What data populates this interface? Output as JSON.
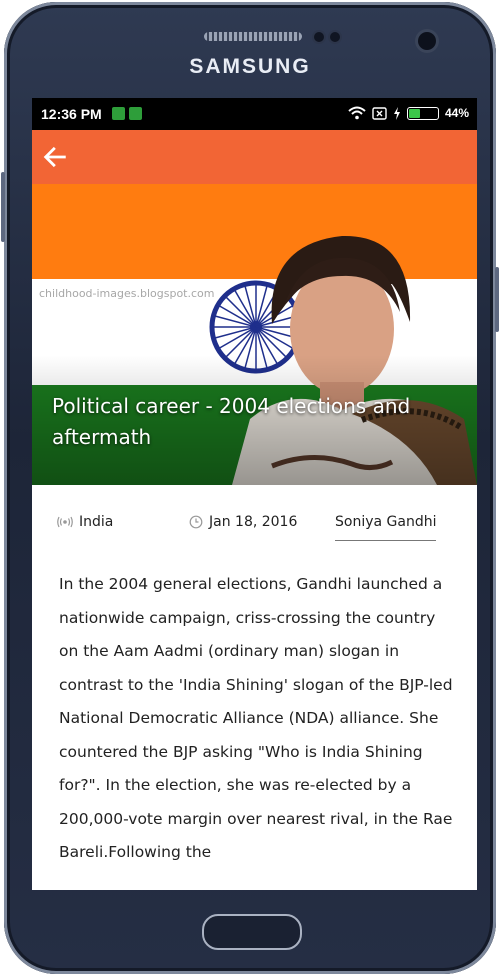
{
  "device": {
    "brand": "SAMSUNG"
  },
  "status_bar": {
    "time": "12:36 PM",
    "battery": "44%",
    "battery_level": 0.44
  },
  "toolbar": {
    "back_icon": "arrow-left-icon"
  },
  "hero": {
    "watermark": "childhood-images.blogspot.com",
    "title": "Political career - 2004 elections and aftermath"
  },
  "meta": {
    "location": "India",
    "date": "Jan 18, 2016",
    "author": "Soniya Gandhi"
  },
  "article": {
    "body": "In the 2004 general elections, Gandhi launched a nationwide campaign, criss-crossing the country on the Aam Aadmi (ordinary man) slogan in contrast to the 'India Shining' slogan of the BJP-led National Democratic Alliance (NDA) alliance. She countered the BJP asking \"Who is India Shining for?\". In the election, she was re-elected by a 200,000-vote margin over nearest rival, in the Rae Bareli.Following the"
  },
  "colors": {
    "toolbar": "#f26535",
    "saffron": "#ff7c10",
    "green": "#1a7a1e"
  }
}
